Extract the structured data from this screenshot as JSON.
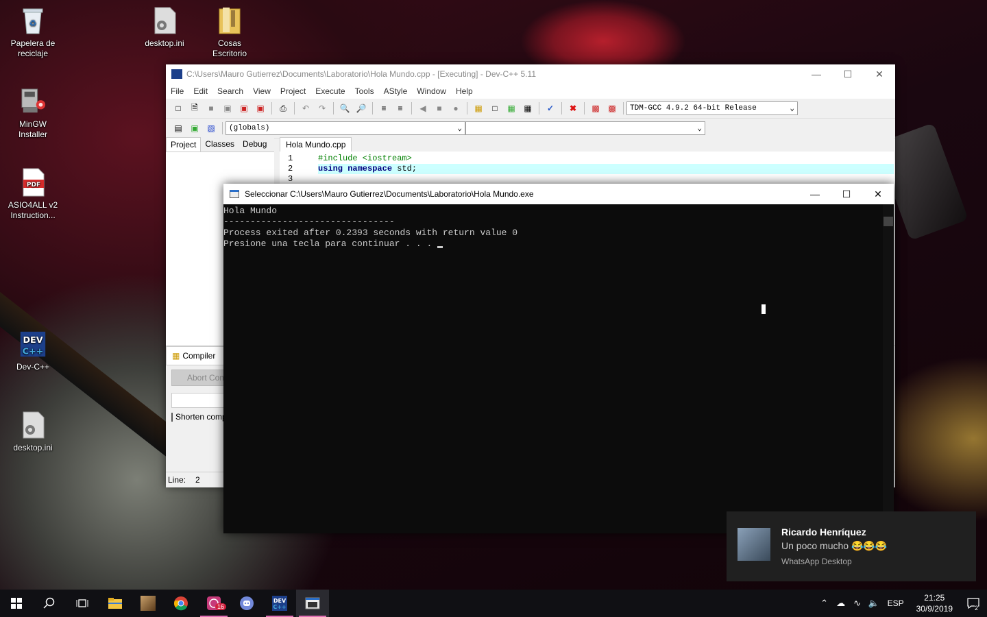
{
  "desktop": {
    "icons": [
      {
        "label": "Papelera de reciclaje",
        "icon": "recycle-bin-icon"
      },
      {
        "label": "desktop.ini",
        "icon": "settings-file-icon"
      },
      {
        "label": "Cosas Escritorio",
        "icon": "folder-icon"
      },
      {
        "label": "MinGW Installer",
        "icon": "installer-icon"
      },
      {
        "label": "ASIO4ALL v2 Instruction...",
        "icon": "pdf-icon"
      },
      {
        "label": "Dev-C++",
        "icon": "devcpp-icon"
      },
      {
        "label": "desktop.ini",
        "icon": "settings-file-icon"
      }
    ]
  },
  "devcpp": {
    "title": "C:\\Users\\Mauro Gutierrez\\Documents\\Laboratorio\\Hola Mundo.cpp - [Executing] - Dev-C++ 5.11",
    "menu": [
      "File",
      "Edit",
      "Search",
      "View",
      "Project",
      "Execute",
      "Tools",
      "AStyle",
      "Window",
      "Help"
    ],
    "compiler_select": "TDM-GCC 4.9.2 64-bit Release",
    "globals_select": "(globals)",
    "members_select": "",
    "left_tabs": [
      "Project",
      "Classes",
      "Debug"
    ],
    "file_tab": "Hola Mundo.cpp",
    "code": [
      {
        "n": "1",
        "text": "#include <iostream>"
      },
      {
        "n": "2",
        "kw": "using namespace",
        "rest": " std;"
      },
      {
        "n": "3",
        "text": ""
      }
    ],
    "bottom_tab": "Compiler",
    "abort_button": "Abort Compilation",
    "shorten_label": "Shorten compiler paths",
    "status_line_label": "Line:",
    "status_line_value": "2"
  },
  "console": {
    "title": "Seleccionar C:\\Users\\Mauro Gutierrez\\Documents\\Laboratorio\\Hola Mundo.exe",
    "lines": [
      "Hola Mundo",
      "--------------------------------",
      "Process exited after 0.2393 seconds with return value 0",
      "Presione una tecla para continuar . . . "
    ]
  },
  "toast": {
    "sender": "Ricardo Henríquez",
    "message": "Un poco mucho 😂😂😂",
    "app": "WhatsApp Desktop"
  },
  "taskbar": {
    "apps": [
      "start-icon",
      "search-icon",
      "task-view-icon",
      "file-explorer-icon",
      "photo-app-icon",
      "chrome-icon",
      "whatsapp-icon",
      "discord-icon",
      "devcpp-icon",
      "console-icon"
    ],
    "whatsapp_badge": "16",
    "language": "ESP",
    "time": "21:25",
    "date": "30/9/2019",
    "notification_count": "2"
  },
  "colors": {
    "console_bg": "#0c0c0c",
    "console_text": "#cccccc",
    "taskbar_bg": "#101014",
    "code_keyword": "#000080",
    "code_preproc": "#008000",
    "highlight_line": "#ccffff"
  }
}
